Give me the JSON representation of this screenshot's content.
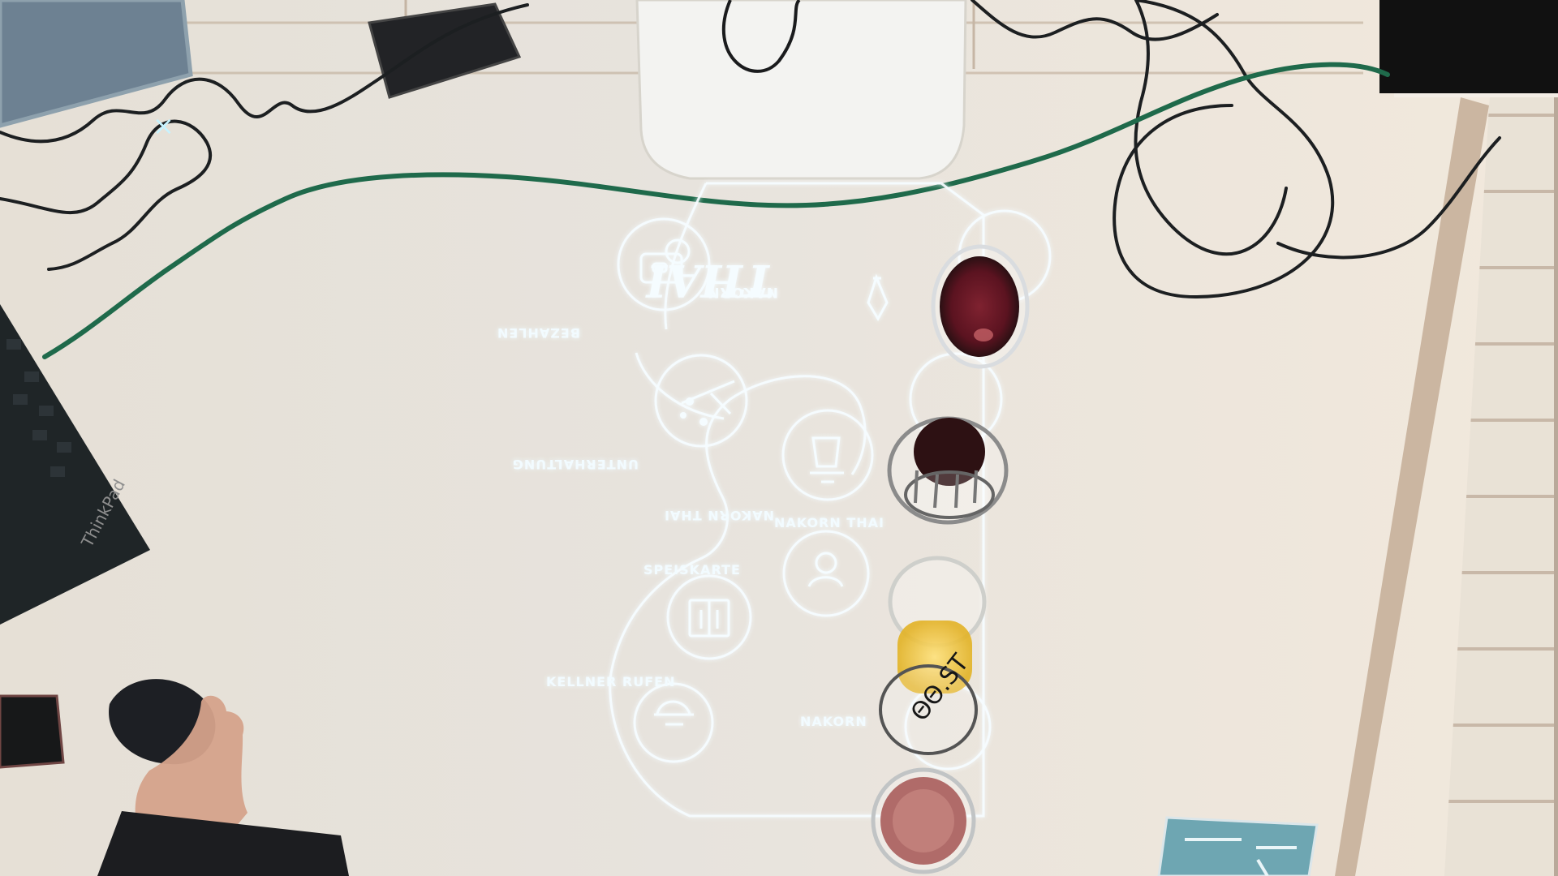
{
  "menu": {
    "top_labels": {
      "brand_small": "NAKORN",
      "brand_big": "THAI",
      "pay": "BEZAHLEN",
      "entertain": "UNTERHALTUNG",
      "center_top": "NAKORN THAI",
      "center_bottom": "NAKORN THAI",
      "menu": "SPEISKARTE",
      "call": "KELLNER RUFEN",
      "bottom_brand": "NAKORN"
    }
  },
  "objects": {
    "close_glyph": "×",
    "glass_text": "ΘΘ.ST"
  }
}
